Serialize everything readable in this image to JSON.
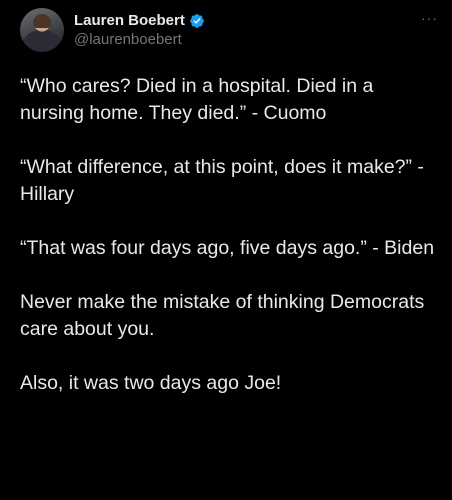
{
  "author": {
    "display_name": "Lauren Boebert",
    "handle": "@laurenboebert",
    "avatar": "avatar-photo",
    "verified_icon": "verified-badge-icon"
  },
  "more_icon": "more-icon",
  "more_label": "···",
  "paragraphs": [
    "“Who cares? Died in a hospital. Died in a nursing home. They died.” - Cuomo",
    "“What difference, at this point, does it make?” - Hillary",
    "“That was four days ago, five days ago.” - Biden",
    "Never make the mistake of thinking Democrats care about you.",
    "Also, it was two days ago Joe!"
  ],
  "colors": {
    "background": "#000000",
    "text": "#e7e9ea",
    "secondary": "#71767b",
    "verified": "#1d9bf0"
  }
}
